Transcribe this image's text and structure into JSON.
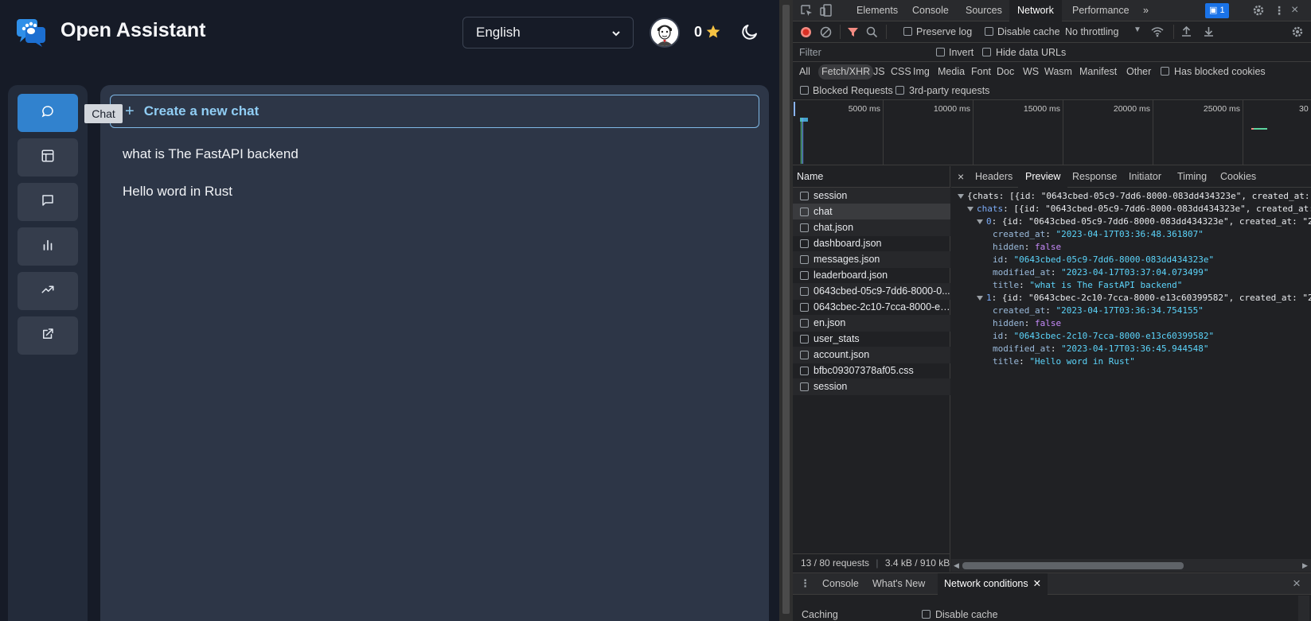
{
  "app": {
    "title": "Open Assistant",
    "language": "English",
    "score": "0",
    "tooltip": "Chat",
    "new_chat_label": "Create a new chat",
    "new_chat_plus": "+",
    "chats": [
      {
        "title": "what is The FastAPI backend"
      },
      {
        "title": "Hello word in Rust"
      }
    ],
    "nav_icons": [
      "chat-icon",
      "layout-icon",
      "message-icon",
      "bar-chart-icon",
      "trending-up-icon",
      "external-link-icon"
    ],
    "colors": {
      "accent": "#3182ce",
      "new_chat": "#90cdf4",
      "star": "#f6c343"
    }
  },
  "devtools": {
    "tabs": [
      "Elements",
      "Console",
      "Sources",
      "Network",
      "Performance"
    ],
    "active_tab": "Network",
    "more_tabs": "»",
    "badge_count": "1",
    "toolbar": {
      "preserve_log": "Preserve log",
      "disable_cache": "Disable cache",
      "throttling": "No throttling"
    },
    "filter": {
      "placeholder": "Filter",
      "invert": "Invert",
      "hide_data_urls": "Hide data URLs"
    },
    "types": [
      "All",
      "Fetch/XHR",
      "JS",
      "CSS",
      "Img",
      "Media",
      "Font",
      "Doc",
      "WS",
      "Wasm",
      "Manifest",
      "Other"
    ],
    "active_type": "Fetch/XHR",
    "has_blocked_cookies": "Has blocked cookies",
    "blocked_requests": "Blocked Requests",
    "third_party": "3rd-party requests",
    "overview_labels": [
      "5000 ms",
      "10000 ms",
      "15000 ms",
      "20000 ms",
      "25000 ms",
      "30"
    ],
    "name_header": "Name",
    "requests": [
      "session",
      "chat",
      "chat.json",
      "dashboard.json",
      "messages.json",
      "leaderboard.json",
      "0643cbed-05c9-7dd6-8000-0...",
      "0643cbec-2c10-7cca-8000-e1...",
      "en.json",
      "user_stats",
      "account.json",
      "bfbc09307378af05.css",
      "session"
    ],
    "selected_request": "chat",
    "detail_close": "×",
    "detail_tabs": [
      "Headers",
      "Preview",
      "Response",
      "Initiator",
      "Timing",
      "Cookies"
    ],
    "active_detail_tab": "Preview",
    "preview": {
      "root": "{chats: [{id: \"0643cbed-05c9-7dd6-8000-083dd434323e\", created_at:",
      "chats_key": "chats",
      "chats_summary": ": [{id: \"0643cbed-05c9-7dd6-8000-083dd434323e\", created_at:",
      "items": [
        {
          "index": "0",
          "summary": ": {id: \"0643cbed-05c9-7dd6-8000-083dd434323e\", created_at: \"2",
          "created_at": "\"2023-04-17T03:36:48.361807\"",
          "hidden": "false",
          "id": "\"0643cbed-05c9-7dd6-8000-083dd434323e\"",
          "modified_at": "\"2023-04-17T03:37:04.073499\"",
          "title": "\"what is The FastAPI backend\""
        },
        {
          "index": "1",
          "summary": ": {id: \"0643cbec-2c10-7cca-8000-e13c60399582\", created_at: \"2",
          "created_at": "\"2023-04-17T03:36:34.754155\"",
          "hidden": "false",
          "id": "\"0643cbec-2c10-7cca-8000-e13c60399582\"",
          "modified_at": "\"2023-04-17T03:36:45.944548\"",
          "title": "\"Hello word in Rust\""
        }
      ],
      "keys": {
        "created_at": "created_at",
        "hidden": "hidden",
        "id": "id",
        "modified_at": "modified_at",
        "title": "title"
      }
    },
    "status": "13 / 80 requests",
    "status_size": "3.4 kB / 910 kB",
    "drawer_tabs": [
      "Console",
      "What's New",
      "Network conditions"
    ],
    "active_drawer_tab": "Network conditions",
    "drawer": {
      "caching": "Caching",
      "disable_cache": "Disable cache"
    }
  }
}
